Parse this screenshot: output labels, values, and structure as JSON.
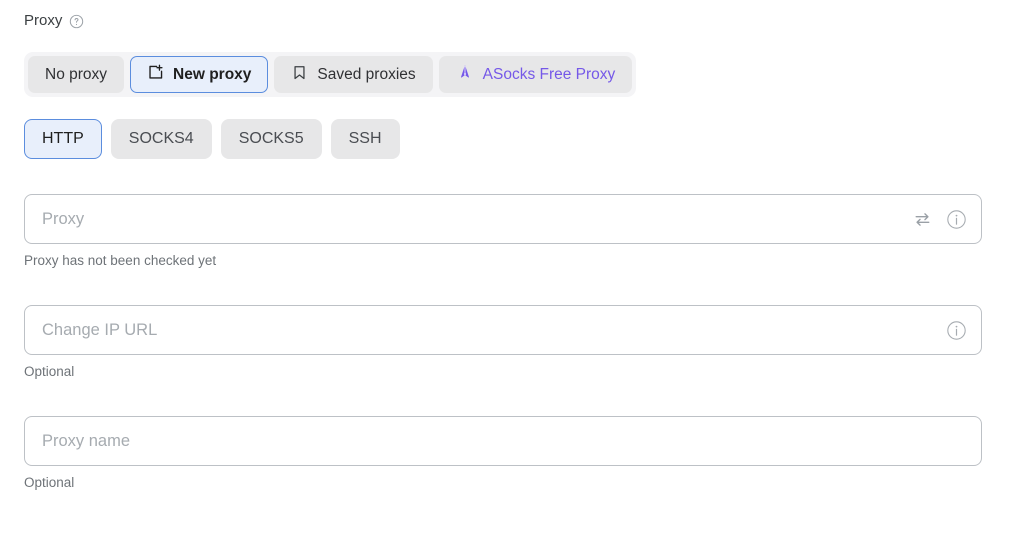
{
  "section": {
    "label": "Proxy",
    "help_icon": "question-circle-icon"
  },
  "proxy_source": {
    "options": [
      {
        "label": "No proxy",
        "icon": null,
        "selected": false
      },
      {
        "label": "New proxy",
        "icon": "new-window-plus-icon",
        "selected": true
      },
      {
        "label": "Saved proxies",
        "icon": "bookmark-icon",
        "selected": false
      },
      {
        "label": "ASocks Free Proxy",
        "icon": "asocks-logo-icon",
        "selected": false,
        "brand": true
      }
    ],
    "selected": "New proxy"
  },
  "protocol": {
    "options": [
      {
        "label": "HTTP",
        "selected": true
      },
      {
        "label": "SOCKS4",
        "selected": false
      },
      {
        "label": "SOCKS5",
        "selected": false
      },
      {
        "label": "SSH",
        "selected": false
      }
    ],
    "selected": "HTTP"
  },
  "fields": {
    "proxy": {
      "placeholder": "Proxy",
      "value": "",
      "helper": "Proxy has not been checked yet",
      "swap_icon": "swap-arrows-icon",
      "info_icon": "info-circle-icon"
    },
    "change_ip_url": {
      "placeholder": "Change IP URL",
      "value": "",
      "helper": "Optional",
      "info_icon": "info-circle-icon"
    },
    "proxy_name": {
      "placeholder": "Proxy name",
      "value": "",
      "helper": "Optional"
    }
  },
  "colors": {
    "accent_blue": "#5b8dde",
    "selected_bg": "#e8effb",
    "neutral_bg": "#e7e7e8",
    "brand_purple": "#7558e8",
    "border_grey": "#bdc1c6",
    "helper_text": "#6e7378"
  }
}
